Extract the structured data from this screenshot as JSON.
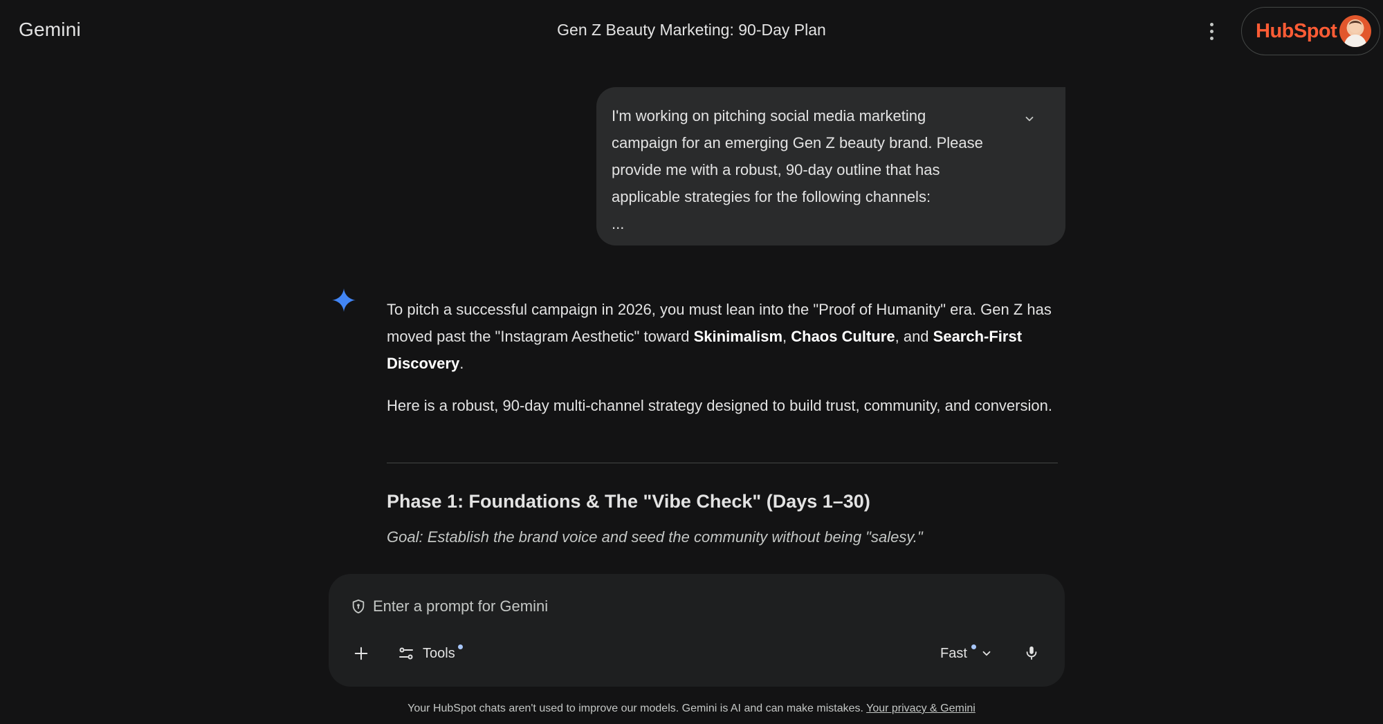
{
  "header": {
    "brand": "Gemini",
    "chat_title": "Gen Z Beauty Marketing: 90-Day Plan",
    "account_logo": "HubSpot",
    "icons": {
      "menu": "more-vert-icon",
      "avatar": "user-avatar"
    }
  },
  "user_message": {
    "lines": [
      "I'm working on pitching social media marketing",
      "campaign for an emerging Gen Z beauty brand. Please",
      "provide me with a robust, 90-day outline that has",
      "applicable strategies for the following channels:",
      "..."
    ],
    "expand_icon": "chevron-down-icon"
  },
  "response": {
    "intro": {
      "part1": "To pitch a successful campaign in 2026, you must lean into the \"Proof of Humanity\" era. Gen Z has moved past the \"Instagram Aesthetic\" toward ",
      "bold1": "Skinimalism",
      "sep1": ", ",
      "bold2": "Chaos Culture",
      "sep2": ", and ",
      "bold3": "Search-First Discovery",
      "end": "."
    },
    "paragraph2": "Here is a robust, 90-day multi-channel strategy designed to build trust, community, and conversion.",
    "phase1_heading": "Phase 1: Foundations & The \"Vibe Check\" (Days 1–30)",
    "phase1_goal": "Goal: Establish the brand voice and seed the community without being \"salesy.\""
  },
  "composer": {
    "placeholder": "Enter a prompt for Gemini",
    "tools_label": "Tools",
    "mode_label": "Fast",
    "icons": [
      "shield-icon",
      "plus-icon",
      "tools-icon",
      "chevron-down-icon",
      "mic-icon"
    ]
  },
  "footer": {
    "disclaimer": "Your HubSpot chats aren't used to improve our models. Gemini is AI and can make mistakes. ",
    "link": "Your privacy & Gemini"
  },
  "colors": {
    "background": "#131314",
    "surface": "#1e1f20",
    "bubble": "#2a2b2c",
    "text": "#e3e3e3",
    "hubspot_orange": "#ff5c35",
    "gemini_blue": "#4285f4"
  }
}
